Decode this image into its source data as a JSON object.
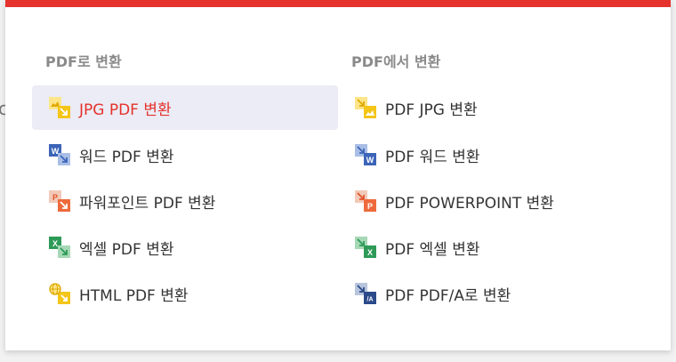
{
  "panel": {
    "accent_color": "#e5322d",
    "to_pdf": {
      "title": "PDF로 변환",
      "items": [
        {
          "label": "JPG PDF 변환",
          "icon": "jpg-to-pdf-icon",
          "active": true
        },
        {
          "label": "워드 PDF 변환",
          "icon": "word-to-pdf-icon",
          "active": false
        },
        {
          "label": "파워포인트 PDF 변환",
          "icon": "powerpoint-to-pdf-icon",
          "active": false
        },
        {
          "label": "엑셀 PDF 변환",
          "icon": "excel-to-pdf-icon",
          "active": false
        },
        {
          "label": "HTML PDF 변환",
          "icon": "html-to-pdf-icon",
          "active": false
        }
      ]
    },
    "from_pdf": {
      "title": "PDF에서 변환",
      "items": [
        {
          "label": "PDF JPG 변환",
          "icon": "pdf-to-jpg-icon"
        },
        {
          "label": "PDF 워드 변환",
          "icon": "pdf-to-word-icon"
        },
        {
          "label": "PDF POWERPOINT 변환",
          "icon": "pdf-to-powerpoint-icon"
        },
        {
          "label": "PDF 엑셀 변환",
          "icon": "pdf-to-excel-icon"
        },
        {
          "label": "PDF PDF/A로 변환",
          "icon": "pdf-to-pdfa-icon"
        }
      ]
    }
  }
}
